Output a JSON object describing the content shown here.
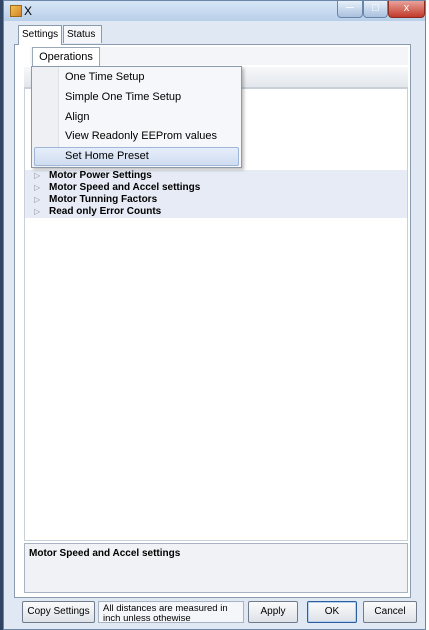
{
  "window": {
    "title": "X",
    "minimize": "─",
    "maximize": "□",
    "close": "x"
  },
  "tabs": [
    {
      "label": "Settings"
    },
    {
      "label": "Status"
    }
  ],
  "menu": {
    "operations_label": "Operations",
    "items": [
      {
        "label": "One Time Setup"
      },
      {
        "label": "Simple One Time Setup"
      },
      {
        "label": "Align"
      },
      {
        "label": "View Readonly EEProm values"
      },
      {
        "label": "Set Home Preset"
      }
    ]
  },
  "property_grid": {
    "categories": [
      {
        "label": "Motor Power Settings"
      },
      {
        "label": "Motor Speed and Accel settings"
      },
      {
        "label": "Motor Tunning Factors"
      },
      {
        "label": "Read only Error Counts"
      }
    ],
    "description_title": "Motor Speed and Accel settings"
  },
  "footer": {
    "copy_label": "Copy Settings",
    "note": "All distances are measured in inch unless othewise",
    "apply_label": "Apply",
    "ok_label": "OK",
    "cancel_label": "Cancel"
  },
  "icons": {
    "expand": "▷"
  },
  "colors": {
    "accent": "#2c5d9e",
    "category_bg": "#e6ebf5",
    "selected_item": "#cfdcf0",
    "close": "#c2392b"
  }
}
